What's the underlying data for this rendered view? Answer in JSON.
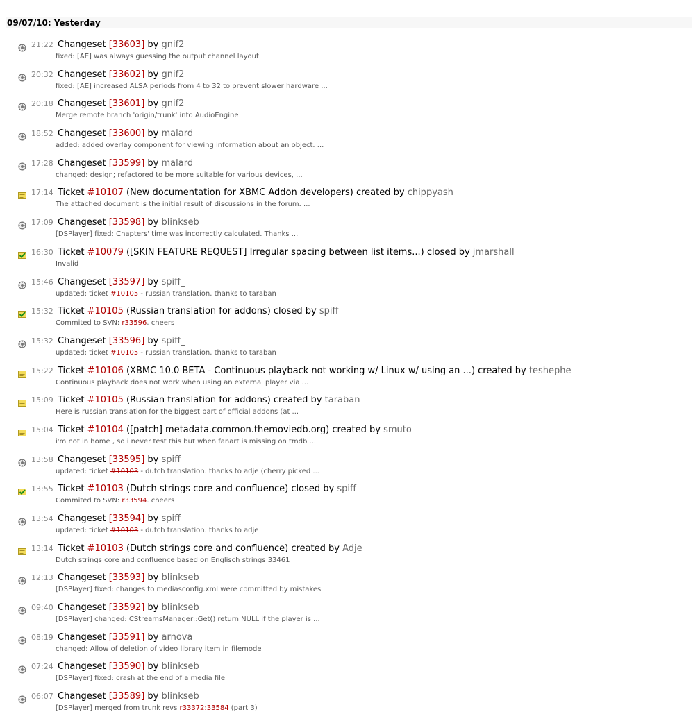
{
  "header": {
    "date": "09/07/10: Yesterday"
  },
  "colors": {
    "link": "#b00000",
    "author": "#666666",
    "time": "#888888"
  },
  "events": [
    {
      "kind": "changeset",
      "icon": "changeset-icon",
      "time": "21:22",
      "pre": "Changeset ",
      "ref": "[33603]",
      "mid": " by ",
      "author": "gnif2",
      "msg": [
        {
          "t": "fixed: [AE] was always guessing the output channel layout"
        }
      ]
    },
    {
      "kind": "changeset",
      "icon": "changeset-icon",
      "time": "20:32",
      "pre": "Changeset ",
      "ref": "[33602]",
      "mid": " by ",
      "author": "gnif2",
      "msg": [
        {
          "t": "fixed: [AE] increased ALSA periods from 4 to 32 to prevent slower hardware ..."
        }
      ]
    },
    {
      "kind": "changeset",
      "icon": "changeset-icon",
      "time": "20:18",
      "pre": "Changeset ",
      "ref": "[33601]",
      "mid": " by ",
      "author": "gnif2",
      "msg": [
        {
          "t": "Merge remote branch 'origin/trunk' into AudioEngine"
        }
      ]
    },
    {
      "kind": "changeset",
      "icon": "changeset-icon",
      "time": "18:52",
      "pre": "Changeset ",
      "ref": "[33600]",
      "mid": " by ",
      "author": "malard",
      "msg": [
        {
          "t": "added: added overlay component for viewing information about an object. ..."
        }
      ]
    },
    {
      "kind": "changeset",
      "icon": "changeset-icon",
      "time": "17:28",
      "pre": "Changeset ",
      "ref": "[33599]",
      "mid": " by ",
      "author": "malard",
      "msg": [
        {
          "t": "changed: design; refactored to be more suitable for various devices, ..."
        }
      ]
    },
    {
      "kind": "ticket-new",
      "icon": "new-ticket-icon",
      "time": "17:14",
      "pre": "Ticket ",
      "ref": "#10107",
      "mid": " (New documentation for XBMC Addon developers) created by ",
      "author": "chippyash",
      "msg": [
        {
          "t": "The attached document is the initial result of discussions in the forum. ..."
        }
      ]
    },
    {
      "kind": "changeset",
      "icon": "changeset-icon",
      "time": "17:09",
      "pre": "Changeset ",
      "ref": "[33598]",
      "mid": " by ",
      "author": "blinkseb",
      "msg": [
        {
          "t": "[DSPlayer] fixed: Chapters' time was incorrectly calculated. Thanks ..."
        }
      ]
    },
    {
      "kind": "ticket-closed",
      "icon": "closed-ticket-icon",
      "time": "16:30",
      "pre": "Ticket ",
      "ref": "#10079",
      "mid": " ([SKIN FEATURE REQUEST] Irregular spacing between list items...) closed by ",
      "author": "jmarshall",
      "msg": [
        {
          "t": "Invalid"
        }
      ]
    },
    {
      "kind": "changeset",
      "icon": "changeset-icon",
      "time": "15:46",
      "pre": "Changeset ",
      "ref": "[33597]",
      "mid": " by ",
      "author": "spiff_",
      "msg": [
        {
          "t": "updated: ticket "
        },
        {
          "t": "#10105",
          "link": "closed"
        },
        {
          "t": " - russian translation. thanks to taraban"
        }
      ]
    },
    {
      "kind": "ticket-closed",
      "icon": "closed-ticket-icon",
      "time": "15:32",
      "pre": "Ticket ",
      "ref": "#10105",
      "mid": " (Russian translation for addons) closed by ",
      "author": "spiff",
      "msg": [
        {
          "t": "Commited to SVN: "
        },
        {
          "t": "r33596",
          "link": "open"
        },
        {
          "t": ". cheers"
        }
      ]
    },
    {
      "kind": "changeset",
      "icon": "changeset-icon",
      "time": "15:32",
      "pre": "Changeset ",
      "ref": "[33596]",
      "mid": " by ",
      "author": "spiff_",
      "msg": [
        {
          "t": "updated: ticket "
        },
        {
          "t": "#10105",
          "link": "closed"
        },
        {
          "t": " - russian translation. thanks to taraban"
        }
      ]
    },
    {
      "kind": "ticket-new",
      "icon": "new-ticket-icon",
      "time": "15:22",
      "pre": "Ticket ",
      "ref": "#10106",
      "mid": " (XBMC 10.0 BETA - Continuous playback not working w/ Linux w/ using an ...) created by ",
      "author": "teshephe",
      "msg": [
        {
          "t": "Continuous playback does not work when using an external player via ..."
        }
      ]
    },
    {
      "kind": "ticket-new",
      "icon": "new-ticket-icon",
      "time": "15:09",
      "pre": "Ticket ",
      "ref": "#10105",
      "mid": " (Russian translation for addons) created by ",
      "author": "taraban",
      "msg": [
        {
          "t": "Here is russian translation for the biggest part of official addons (at ..."
        }
      ]
    },
    {
      "kind": "ticket-new",
      "icon": "new-ticket-icon",
      "time": "15:04",
      "pre": "Ticket ",
      "ref": "#10104",
      "mid": " ([patch] metadata.common.themoviedb.org) created by ",
      "author": "smuto",
      "msg": [
        {
          "t": "i'm not in home , so i never test this but when fanart is missing on tmdb ..."
        }
      ]
    },
    {
      "kind": "changeset",
      "icon": "changeset-icon",
      "time": "13:58",
      "pre": "Changeset ",
      "ref": "[33595]",
      "mid": " by ",
      "author": "spiff_",
      "msg": [
        {
          "t": "updated: ticket "
        },
        {
          "t": "#10103",
          "link": "closed"
        },
        {
          "t": " - dutch translation. thanks to adje (cherry picked ..."
        }
      ]
    },
    {
      "kind": "ticket-closed",
      "icon": "closed-ticket-icon",
      "time": "13:55",
      "pre": "Ticket ",
      "ref": "#10103",
      "mid": " (Dutch strings core and confluence) closed by ",
      "author": "spiff",
      "msg": [
        {
          "t": "Commited to SVN: "
        },
        {
          "t": "r33594",
          "link": "open"
        },
        {
          "t": ". cheers"
        }
      ]
    },
    {
      "kind": "changeset",
      "icon": "changeset-icon",
      "time": "13:54",
      "pre": "Changeset ",
      "ref": "[33594]",
      "mid": " by ",
      "author": "spiff_",
      "msg": [
        {
          "t": "updated: ticket "
        },
        {
          "t": "#10103",
          "link": "closed"
        },
        {
          "t": " - dutch translation. thanks to adje"
        }
      ]
    },
    {
      "kind": "ticket-new",
      "icon": "new-ticket-icon",
      "time": "13:14",
      "pre": "Ticket ",
      "ref": "#10103",
      "mid": " (Dutch strings core and confluence) created by ",
      "author": "Adje",
      "msg": [
        {
          "t": "Dutch strings core and confluence based on Englisch strings 33461"
        }
      ]
    },
    {
      "kind": "changeset",
      "icon": "changeset-icon",
      "time": "12:13",
      "pre": "Changeset ",
      "ref": "[33593]",
      "mid": " by ",
      "author": "blinkseb",
      "msg": [
        {
          "t": "[DSPlayer] fixed: changes to mediasconfig.xml were committed by mistakes"
        }
      ]
    },
    {
      "kind": "changeset",
      "icon": "changeset-icon",
      "time": "09:40",
      "pre": "Changeset ",
      "ref": "[33592]",
      "mid": " by ",
      "author": "blinkseb",
      "msg": [
        {
          "t": "[DSPlayer] changed: CStreamsManager::Get() return NULL if the player is ..."
        }
      ]
    },
    {
      "kind": "changeset",
      "icon": "changeset-icon",
      "time": "08:19",
      "pre": "Changeset ",
      "ref": "[33591]",
      "mid": " by ",
      "author": "arnova",
      "msg": [
        {
          "t": "changed: Allow of deletion of video library item in filemode"
        }
      ]
    },
    {
      "kind": "changeset",
      "icon": "changeset-icon",
      "time": "07:24",
      "pre": "Changeset ",
      "ref": "[33590]",
      "mid": " by ",
      "author": "blinkseb",
      "msg": [
        {
          "t": "[DSPlayer] fixed: crash at the end of a media file"
        }
      ]
    },
    {
      "kind": "changeset",
      "icon": "changeset-icon",
      "time": "06:07",
      "pre": "Changeset ",
      "ref": "[33589]",
      "mid": " by ",
      "author": "blinkseb",
      "msg": [
        {
          "t": "[DSPlayer] merged from trunk revs "
        },
        {
          "t": "r33372:33584",
          "link": "open"
        },
        {
          "t": " (part 3)"
        }
      ]
    }
  ]
}
